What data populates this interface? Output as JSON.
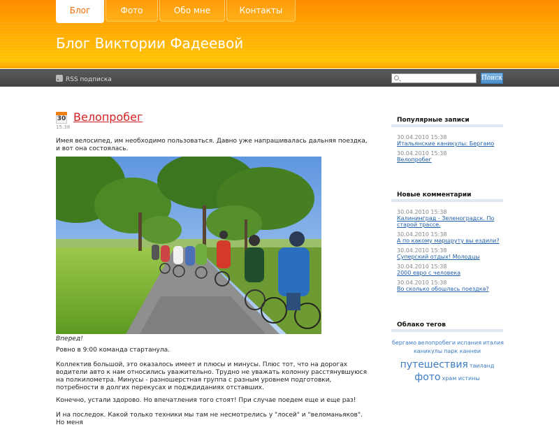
{
  "nav": {
    "tabs": [
      {
        "label": "Блог",
        "active": true
      },
      {
        "label": "Фото",
        "active": false
      },
      {
        "label": "Обо мне",
        "active": false
      },
      {
        "label": "Контакты",
        "active": false
      }
    ]
  },
  "site_title": "Блог Виктории Фадеевой",
  "toolbar": {
    "rss_label": "RSS подписка",
    "search_placeholder": "",
    "search_button": "Поиск"
  },
  "post": {
    "date_day": "30",
    "time": "15:38",
    "title": "Велопробег",
    "intro": "Имея велосипед, им необходимо пользоваться. Давно уже напрашивалась дальняя поездка, и вот она состоялась.",
    "caption": "Вперед!",
    "p1": "Ровно в 9:00 команда стартанула.",
    "p2": "Коллектив большой, это оказалось имеет и плюсы и минусы. Плюс тот, что на дорогах водители авто к нам относились уважительно. Трудно не уважать колонну расстянувшуюся на полкилометра. Минусы - разношерстная группа с разным уровнем подготовки, потребности в долгих перекусах и подждиданиях отставших.",
    "p3": "Конечно, устали здорово. Но впечатления того стоят! При случае поедем еще и еще раз!",
    "p4": "И на последок. Какой только техники мы там не несмотрелись у \"лосей\" и \"веломаньяков\". Но меня"
  },
  "sidebar": {
    "popular": {
      "title": "Популярные записи",
      "items": [
        {
          "date": "30.04.2010 15:38",
          "link": "Итальянские каникулы: Бергамо"
        },
        {
          "date": "30.04.2010 15:38",
          "link": "Велопробег"
        }
      ]
    },
    "comments": {
      "title": "Новые комментарии",
      "items": [
        {
          "date": "30.04.2010 15:38",
          "link": "Калининград - Зеленоградск. По старой трассе."
        },
        {
          "date": "30.04.2010 15:38",
          "link": "А по какому маршруту вы ездили?"
        },
        {
          "date": "30.04.2010 15:38",
          "link": "Суперский отдых! Молодцы"
        },
        {
          "date": "30.04.2010 15:38",
          "link": "2000 евро с человека"
        },
        {
          "date": "30.04.2010 15:38",
          "link": "Во сколько обошлась поездка?"
        }
      ]
    },
    "tags": {
      "title": "Облако тегов",
      "items": [
        {
          "label": "бергамо"
        },
        {
          "label": "велопробеги"
        },
        {
          "label": "испания"
        },
        {
          "label": "италия"
        },
        {
          "label": "каникулы"
        },
        {
          "label": "парк каннеи"
        },
        {
          "label": "путешествия"
        },
        {
          "label": "таиланд"
        },
        {
          "label": "фото"
        },
        {
          "label": "храм истины"
        }
      ]
    }
  },
  "colors": {
    "header_orange": "#ff9a00",
    "title_red": "#d32222",
    "link_blue": "#1f5fa8",
    "tag_blue": "#3b7cc3"
  }
}
